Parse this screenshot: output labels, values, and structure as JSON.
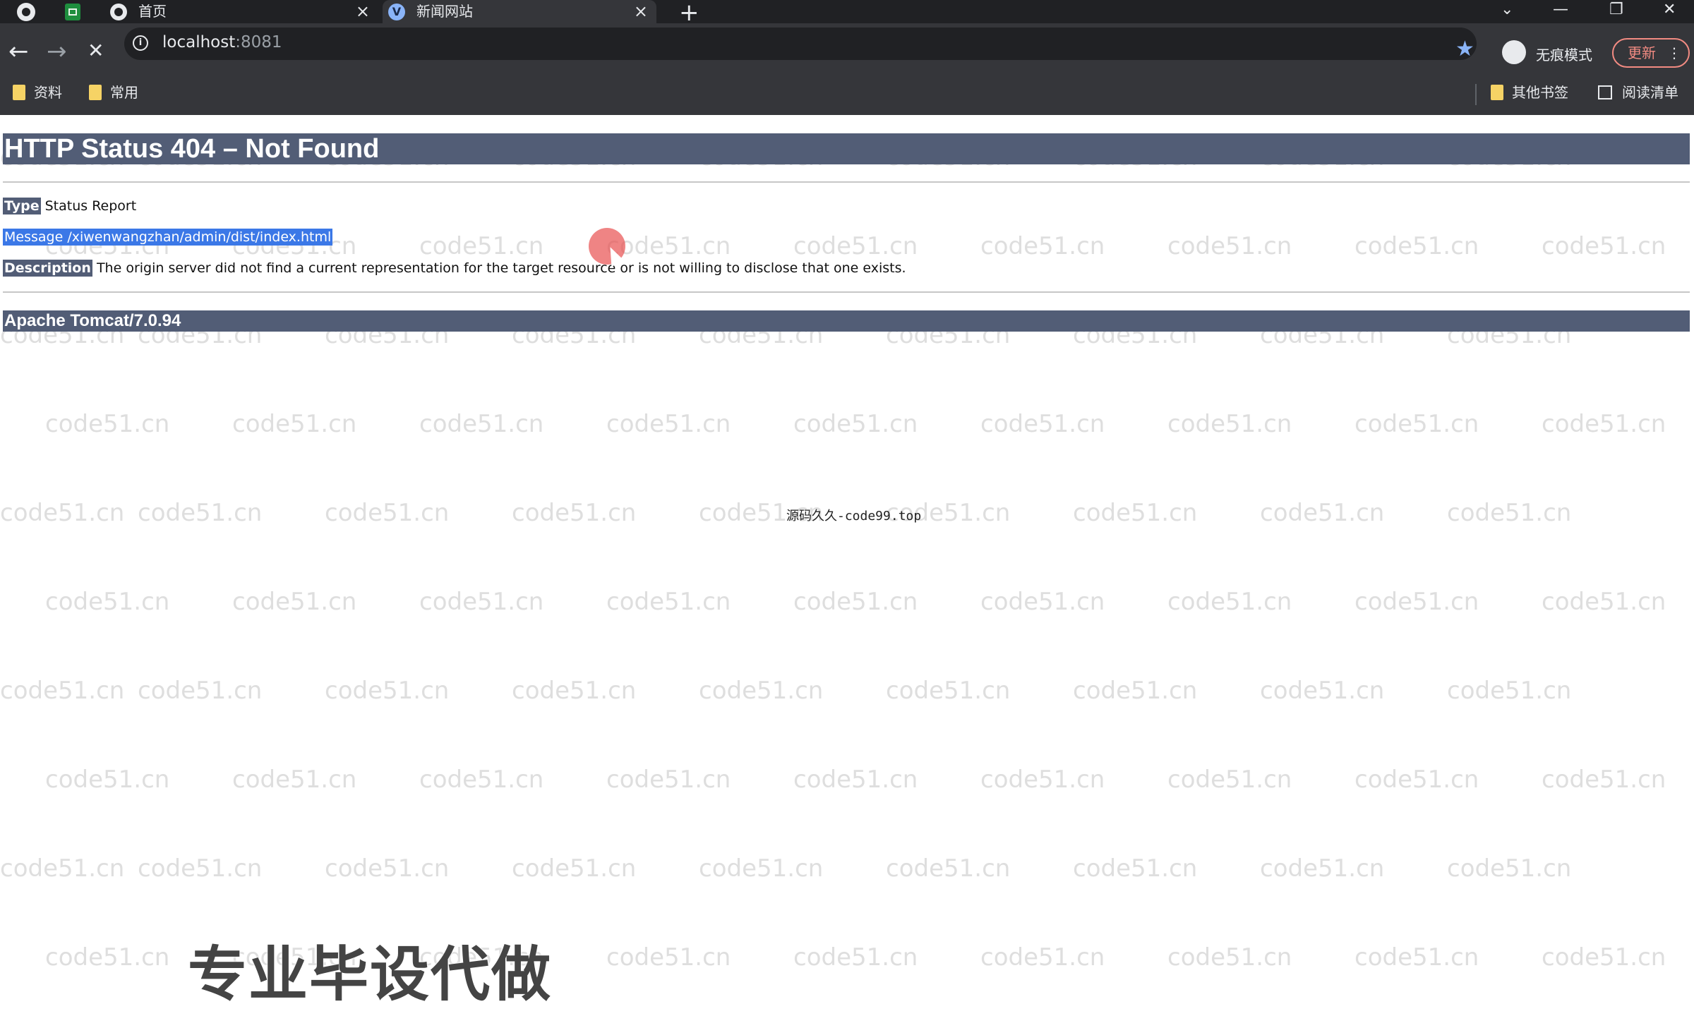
{
  "browser": {
    "tabs": [
      {
        "title": "首页",
        "close": "×",
        "active": false
      },
      {
        "title": "新闻网站",
        "close": "×",
        "active": true
      }
    ],
    "new_tab": "+",
    "window_controls": {
      "dropdown": "⌄",
      "minimize": "—",
      "restore": "❐",
      "close": "✕"
    },
    "nav": {
      "back": "←",
      "forward": "→",
      "stop": "✕"
    },
    "address": {
      "host": "localhost",
      "port": ":8081",
      "info": "i"
    },
    "star_icon": "★",
    "incognito_label": "无痕模式",
    "update_label": "更新",
    "menu_label": "⋮",
    "bookmarks_left": [
      "资料",
      "常用"
    ],
    "bookmarks_right": {
      "other": "其他书签",
      "reading_list": "阅读清单"
    }
  },
  "page": {
    "heading": "HTTP Status 404 – Not Found",
    "type_label": "Type",
    "type_value": "Status Report",
    "message_label": "Message",
    "message_value": "/xiwenwangzhan/admin/dist/index.html",
    "description_label": "Description",
    "description_value": "The origin server did not find a current representation for the target resource or is not willing to disclose that one exists.",
    "server_footer": "Apache Tomcat/7.0.94"
  },
  "overlay": {
    "watermark_text": "code51.cn",
    "center_note": "源码久久-code99.top",
    "promo_text": "专业毕设代做"
  },
  "colors": {
    "chrome_dark": "#202124",
    "chrome_toolbar": "#35363a",
    "tomcat_bar": "#525d76",
    "selection": "#3b78e7",
    "update_accent": "#f28b82"
  }
}
